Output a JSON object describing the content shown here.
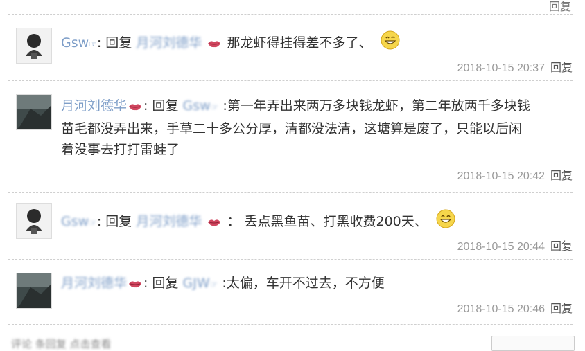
{
  "top": {
    "reply_label": "回复"
  },
  "comments": [
    {
      "author": "Gsw",
      "verb": "回复",
      "target": "月河刘德华",
      "text": "那龙虾得挂得差不多了、",
      "time": "2018-10-15 20:37",
      "reply_label": "回复"
    },
    {
      "author": "月河刘德华",
      "verb": "回复",
      "target": "Gsw",
      "line1": ":第一年弄出来两万多块钱龙虾，第二年放两千多块钱",
      "line2": "苗毛都没弄出来，手草二十多公分厚，清都没法清，这塘算是废了，只能以后闲",
      "line3": "着没事去打打雷蛙了",
      "time": "2018-10-15 20:42",
      "reply_label": "回复"
    },
    {
      "author": "Gsw",
      "verb": "回复",
      "target": "月河刘德华",
      "text": "：  丢点黑鱼苗、打黑收费200天、",
      "time": "2018-10-15 20:44",
      "reply_label": "回复"
    },
    {
      "author": "月河刘德华",
      "verb": "回复",
      "target": "GJW",
      "text": ":太偏，车开不过去，不方便",
      "time": "2018-10-15 20:46",
      "reply_label": "回复"
    }
  ],
  "bottom": {
    "cut_text": "评论 条回复 点击查看"
  },
  "colors": {
    "name": "#7e9ec8",
    "meta": "#999999",
    "separator": "#cfcfcf"
  },
  "icons": [
    "lips-icon",
    "smile-emoji-icon",
    "hand-pointing-icon"
  ]
}
